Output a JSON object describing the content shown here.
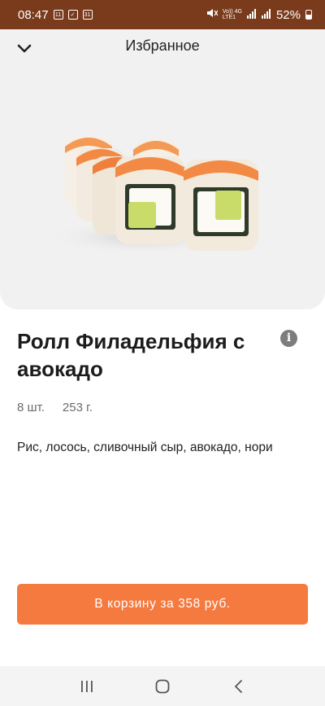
{
  "status_bar": {
    "time": "08:47",
    "notif_1": "11",
    "notif_3": "31",
    "network_top": "Vo)) 4G",
    "network_bottom": "LTE1",
    "battery": "52%"
  },
  "header": {
    "title": "Избранное"
  },
  "product": {
    "name": "Ролл Филадельфия с авокадо",
    "pieces": "8 шт.",
    "weight": "253 г.",
    "composition": "Рис, лосось, сливочный сыр, авокадо, нори",
    "image_icon": "sushi-roll-image"
  },
  "cart": {
    "button_label": "В корзину за 358 руб."
  },
  "colors": {
    "status_bar": "#7a3b1c",
    "accent": "#f47a3f",
    "hero_bg": "#f1f1f1"
  },
  "icons": {
    "back": "chevron-down-icon",
    "info": "info-icon",
    "nav_recent": "recent-apps-icon",
    "nav_home": "home-icon",
    "nav_back": "back-icon"
  }
}
